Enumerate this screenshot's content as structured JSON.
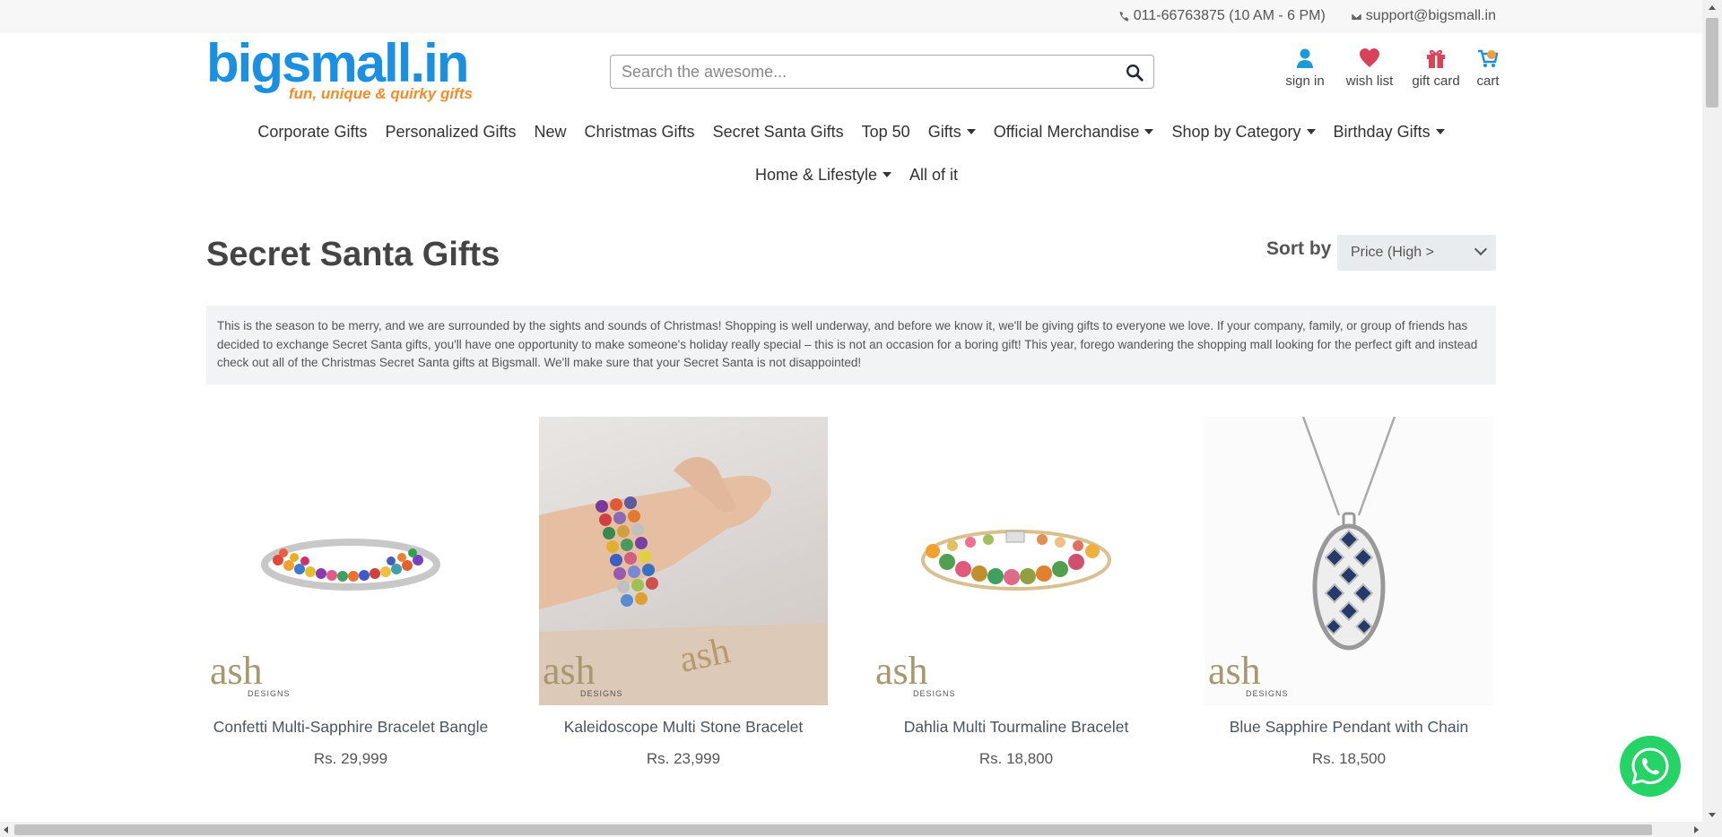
{
  "topbar": {
    "phone": "011-66763875 (10 AM - 6 PM)",
    "email": "support@bigsmall.in"
  },
  "logo": {
    "name": "bigsmall.in",
    "tagline": "fun, unique & quirky gifts"
  },
  "search": {
    "placeholder": "Search the awesome..."
  },
  "header_icons": {
    "signin": "sign in",
    "wishlist": "wish list",
    "giftcard": "gift card",
    "cart": "cart"
  },
  "nav": {
    "row1": [
      {
        "label": "Corporate Gifts",
        "dropdown": false
      },
      {
        "label": "Personalized Gifts",
        "dropdown": false
      },
      {
        "label": "New",
        "dropdown": false
      },
      {
        "label": "Christmas Gifts",
        "dropdown": false
      },
      {
        "label": "Secret Santa Gifts",
        "dropdown": false
      },
      {
        "label": "Top 50",
        "dropdown": false
      },
      {
        "label": "Gifts",
        "dropdown": true
      },
      {
        "label": "Official Merchandise",
        "dropdown": true
      },
      {
        "label": "Shop by Category",
        "dropdown": true
      },
      {
        "label": "Birthday Gifts",
        "dropdown": true
      }
    ],
    "row2": [
      {
        "label": "Home & Lifestyle",
        "dropdown": true
      },
      {
        "label": "All of it",
        "dropdown": false
      }
    ]
  },
  "page": {
    "title": "Secret Santa Gifts",
    "sort_label": "Sort by",
    "sort_value": "Price (High >",
    "description": "This is the season to be merry, and we are surrounded by the sights and sounds of Christmas! Shopping is well underway, and before we know it, we'll be giving gifts to everyone we love. If your company, family, or group of friends has decided to exchange Secret Santa gifts, you'll have one opportunity to make someone's holiday really special – this is not an occasion for a boring gift! This year, forego wandering the shopping mall looking for the perfect gift and instead check out all of the Christmas Secret Santa gifts at Bigsmall. We'll make sure that your Secret Santa is not disappointed!"
  },
  "products": [
    {
      "title": "Confetti Multi-Sapphire Bracelet Bangle",
      "price": "Rs. 29,999",
      "brand": "ash",
      "brand_sub": "DESIGNS"
    },
    {
      "title": "Kaleidoscope Multi Stone Bracelet",
      "price": "Rs. 23,999",
      "brand": "ash",
      "brand_sub": "DESIGNS"
    },
    {
      "title": "Dahlia Multi Tourmaline Bracelet",
      "price": "Rs. 18,800",
      "brand": "ash",
      "brand_sub": "DESIGNS"
    },
    {
      "title": "Blue Sapphire Pendant with Chain",
      "price": "Rs. 18,500",
      "brand": "ash",
      "brand_sub": "DESIGNS"
    }
  ],
  "colors": {
    "logo_blue": "#1b8fe0",
    "logo_orange": "#f28c28",
    "whatsapp_green": "#25d366",
    "heart_red": "#d9435a",
    "signin_blue": "#1b9ad6"
  }
}
